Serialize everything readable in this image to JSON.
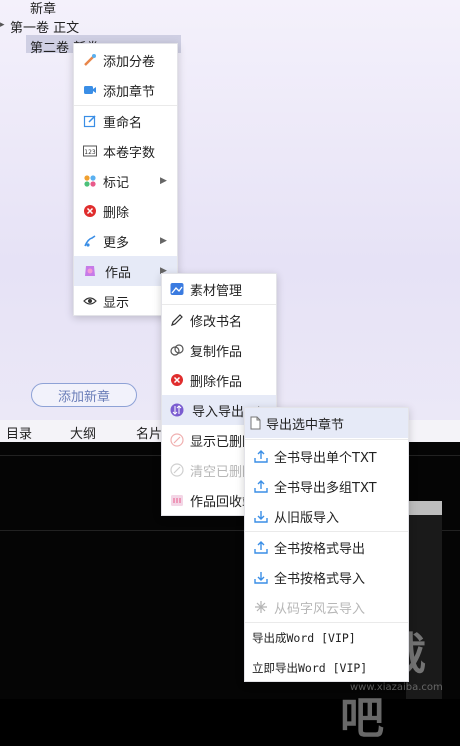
{
  "tree": {
    "items": [
      "新章",
      "第一卷 正文",
      "第二卷 新卷"
    ]
  },
  "add_chapter_button": "添加新章",
  "tabs": [
    "目录",
    "大纲",
    "名片"
  ],
  "menu1": {
    "items": [
      "添加分卷",
      "添加章节",
      "重命名",
      "本卷字数",
      "标记",
      "删除",
      "更多",
      "作品",
      "显示"
    ]
  },
  "menu2": {
    "items": [
      "素材管理",
      "修改书名",
      "复制作品",
      "删除作品",
      "导入导出",
      "显示已删除",
      "清空已删除",
      "作品回收站"
    ]
  },
  "menu3": {
    "items": [
      "导出选中章节",
      "全书导出单个TXT",
      "全书导出多组TXT",
      "从旧版导入",
      "全书按格式导出",
      "全书按格式导入",
      "从码字风云导入",
      "导出成Word [VIP]",
      "立即导出Word [VIP]"
    ]
  },
  "watermark": {
    "text": "下载吧",
    "sub": "www.xiazaiba.com"
  },
  "colors": {
    "accent": "#6a7db8",
    "highlight": "#e6eaf7",
    "delete_red": "#e02d2d"
  }
}
